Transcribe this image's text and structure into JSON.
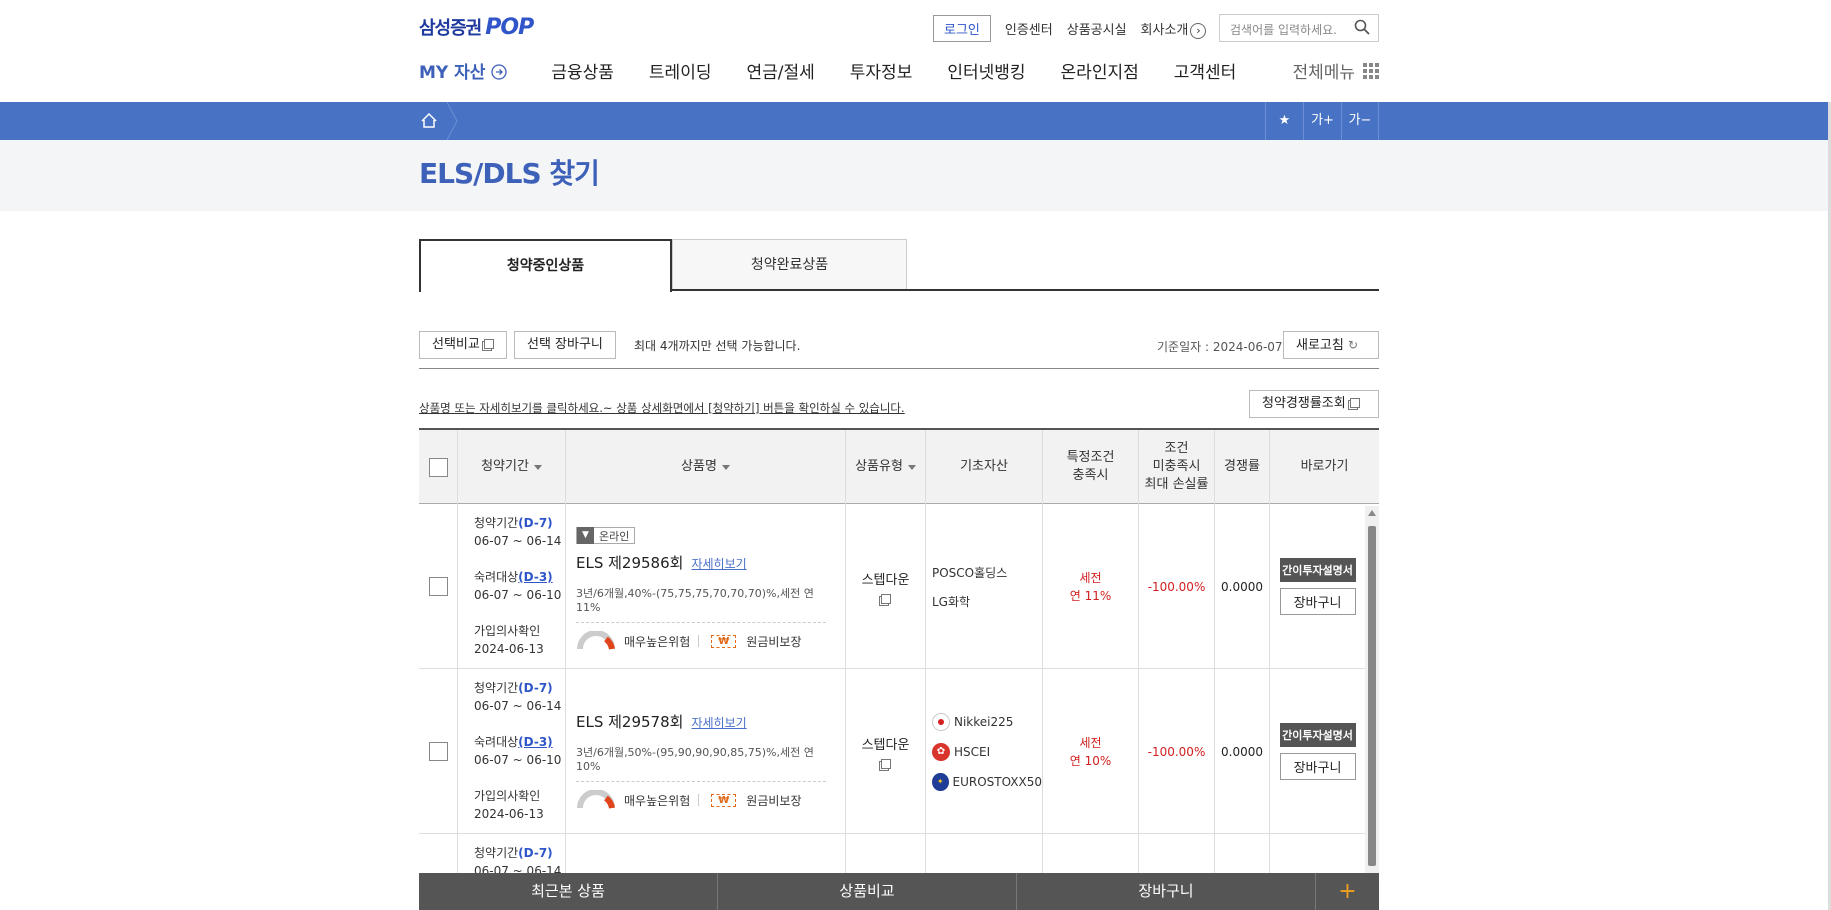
{
  "header": {
    "logo_text": "삼성증권",
    "logo_pop": "POP",
    "login": "로그인",
    "util_links": [
      "인증센터",
      "상품공시실",
      "회사소개"
    ],
    "search_placeholder": "검색어를 입력하세요."
  },
  "gnb": {
    "my": "MY 자산",
    "items": [
      "금융상품",
      "트레이딩",
      "연금/절세",
      "투자정보",
      "인터넷뱅킹",
      "온라인지점",
      "고객센터"
    ],
    "all_menu": "전체메뉴"
  },
  "toolbar": {
    "font_up": "가+",
    "font_down": "가−"
  },
  "page": {
    "title": "ELS/DLS 찾기"
  },
  "tabs": [
    {
      "label": "청약중인상품"
    },
    {
      "label": "청약완료상품"
    }
  ],
  "actions": {
    "compare": "선택비교",
    "cart": "선택 장바구니",
    "max_note": "최대 4개까지만 선택 가능합니다.",
    "base_date": "기준일자 : 2024-06-07",
    "refresh": "새로고침",
    "guide": "상품명 또는 자세히보기를 클릭하세요.~ 상품 상세화면에서 [청약하기] 버튼을 확인하실 수 있습니다.",
    "competition": "청약경쟁률조회"
  },
  "table": {
    "headers": {
      "period": "청약기간",
      "name": "상품명",
      "type": "상품유형",
      "asset": "기초자산",
      "special_1": "특정조건",
      "special_2": "충족시",
      "loss_1": "조건",
      "loss_2": "미충족시",
      "loss_3": "최대 손실률",
      "comp": "경쟁률",
      "go": "바로가기"
    },
    "rows": [
      {
        "period_label": "청약기간",
        "period_d": "(D-7)",
        "period_range": "06-07 ~ 06-14",
        "cool_label": "숙려대상",
        "cool_d": "(D-3)",
        "cool_range": "06-07 ~ 06-10",
        "confirm_label": "가입의사확인",
        "confirm_date": "2024-06-13",
        "online": "온라인",
        "name": "ELS 제29586회",
        "detail": "자세히보기",
        "desc": "3년/6개월,40%-(75,75,75,70,70,70)%,세전 연 11%",
        "risk": "매우높은위험",
        "principal": "원금비보장",
        "type": "스텝다운",
        "assets": [
          "POSCO홀딩스",
          "LG화학"
        ],
        "special_a": "세전",
        "special_b": "연 11%",
        "loss": "-100.00%",
        "comp": "0.0000",
        "doc_btn": "간이투자설명서",
        "cart_btn": "장바구니"
      },
      {
        "period_label": "청약기간",
        "period_d": "(D-7)",
        "period_range": "06-07 ~ 06-14",
        "cool_label": "숙려대상",
        "cool_d": "(D-3)",
        "cool_range": "06-07 ~ 06-10",
        "confirm_label": "가입의사확인",
        "confirm_date": "2024-06-13",
        "name": "ELS 제29578회",
        "detail": "자세히보기",
        "desc": "3년/6개월,50%-(95,90,90,90,85,75)%,세전 연 10%",
        "risk": "매우높은위험",
        "principal": "원금비보장",
        "type": "스텝다운",
        "assets": [
          "Nikkei225",
          "HSCEI",
          "EUROSTOXX50"
        ],
        "special_a": "세전",
        "special_b": "연 10%",
        "loss": "-100.00%",
        "comp": "0.0000",
        "doc_btn": "간이투자설명서",
        "cart_btn": "장바구니"
      },
      {
        "period_label": "청약기간",
        "period_d": "(D-7)",
        "period_range": "06-07 ~ 06-14"
      }
    ]
  },
  "bottombar": {
    "recent": "최근본 상품",
    "compare": "상품비교",
    "cart": "장바구니",
    "plus": "+"
  }
}
